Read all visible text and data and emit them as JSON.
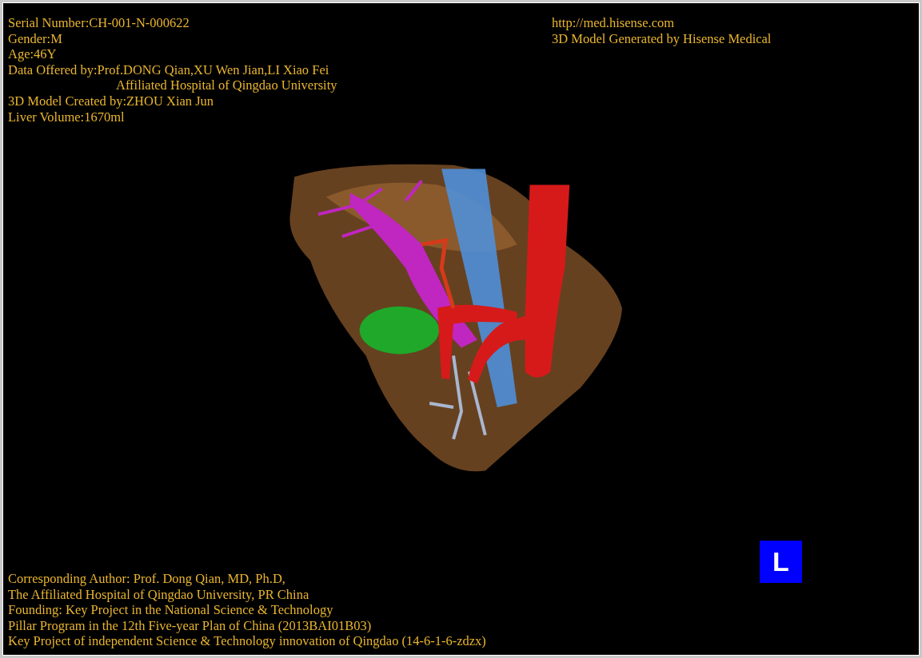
{
  "info_lines": [
    {
      "kind": "line",
      "text": "Serial Number:CH-001-N-000622"
    },
    {
      "kind": "line",
      "text": "Gender:M"
    },
    {
      "kind": "line",
      "text": "Age:46Y"
    },
    {
      "kind": "line",
      "text": "Data Offered by:Prof.DONG Qian,XU Wen Jian,LI Xiao Fei"
    },
    {
      "kind": "continuation",
      "text": "Affiliated Hospital of Qingdao University"
    },
    {
      "kind": "line",
      "text": "3D Model Created by:ZHOU Xian Jun"
    },
    {
      "kind": "line",
      "text": "Liver Volume:1670ml"
    }
  ],
  "website": "http://med.hisense.com",
  "generator": "3D Model Generated by Hisense Medical",
  "credits": [
    "Corresponding Author: Prof. Dong Qian, MD, Ph.D,",
    "The Affiliated Hospital of Qingdao University, PR China",
    "Founding: Key Project in the National Science & Technology",
    "Pillar Program in the 12th Five-year Plan of China (2013BAI01B03)",
    "Key Project of independent Science & Technology innovation of Qingdao (14-6-1-6-zdzx)"
  ],
  "orientation_badge": "L"
}
